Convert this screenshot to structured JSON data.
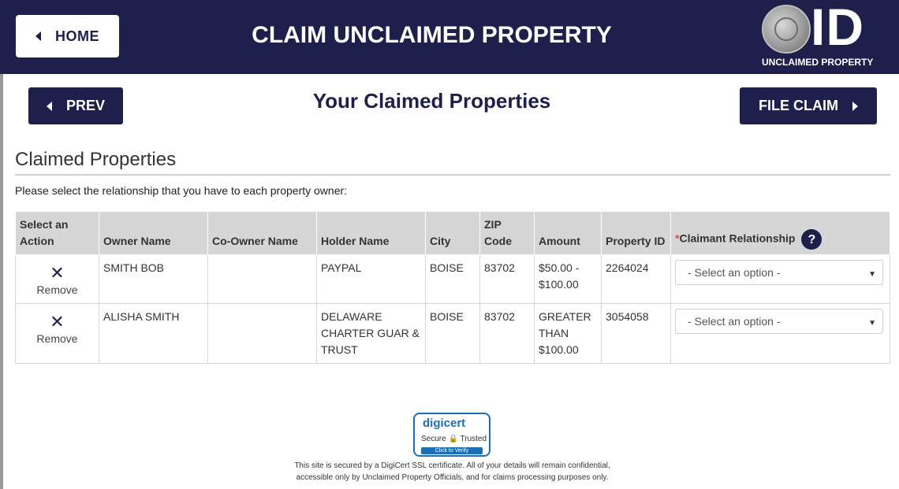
{
  "header": {
    "home_label": "HOME",
    "title": "CLAIM UNCLAIMED PROPERTY",
    "logo": {
      "mark": "ID",
      "subtitle": "UNCLAIMED PROPERTY"
    }
  },
  "nav": {
    "prev_label": "PREV",
    "page_title": "Your Claimed Properties",
    "file_claim_label": "FILE CLAIM"
  },
  "section": {
    "title": "Claimed Properties",
    "instruction": "Please select the relationship that you have to each property owner:"
  },
  "table": {
    "headers": {
      "action": "Select an Action",
      "owner": "Owner Name",
      "coowner": "Co-Owner Name",
      "holder": "Holder Name",
      "city": "City",
      "zip": "ZIP Code",
      "amount": "Amount",
      "property_id": "Property ID",
      "relationship_required_mark": "*",
      "relationship": "Claimant Relationship",
      "help_glyph": "?"
    },
    "rows": [
      {
        "remove_label": "Remove",
        "owner": "SMITH BOB",
        "coowner": "",
        "holder": "PAYPAL",
        "city": "BOISE",
        "zip": "83702",
        "amount": "$50.00 - $100.00",
        "property_id": "2264024",
        "relationship_value": "- Select an option -"
      },
      {
        "remove_label": "Remove",
        "owner": "ALISHA SMITH",
        "coowner": "",
        "holder": "DELAWARE CHARTER GUAR & TRUST",
        "city": "BOISE",
        "zip": "83702",
        "amount": "GREATER THAN $100.00",
        "property_id": "3054058",
        "relationship_value": "- Select an option -"
      }
    ]
  },
  "footer": {
    "digicert_brand": "digicert",
    "digicert_secure": "Secure 🔒 Trusted",
    "digicert_verify": "Click to Verify",
    "note_line1": "This site is secured by a DigiCert SSL certificate. All of your details will remain confidential,",
    "note_line2": "accessible only by Unclaimed Property Officials, and for claims processing purposes only."
  },
  "icons": {
    "back": "caret-left-icon",
    "forward": "caret-right-icon",
    "remove": "close-icon",
    "help": "help-icon",
    "select": "chevron-down-icon"
  },
  "colors": {
    "brand_navy": "#1e1f4b",
    "required_red": "#d9534f",
    "table_header_bg": "#d6d6d6",
    "digicert_blue": "#1a6fb5"
  }
}
